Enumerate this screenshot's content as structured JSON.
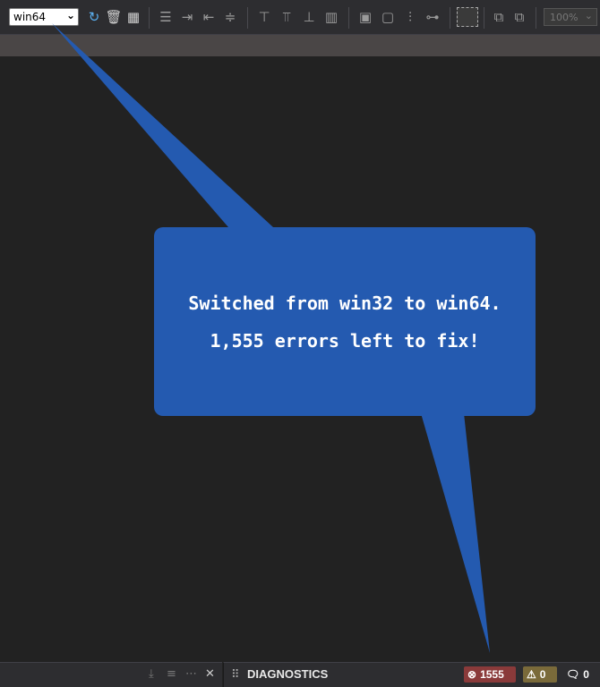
{
  "toolbar": {
    "platform": {
      "selected": "win64"
    },
    "zoom": {
      "selected": "100%"
    },
    "icons": [
      "refresh-icon",
      "delete-icon",
      "grid-icon",
      "align-left-icon",
      "indent-icon",
      "outdent-icon",
      "distribute-icon",
      "align-top-icon",
      "align-middle-icon",
      "align-bottom-icon",
      "chart-icon",
      "group-icon",
      "ungroup-icon",
      "hierarchy-icon",
      "link-icon",
      "select-all-icon",
      "bring-front-icon",
      "send-back-icon"
    ]
  },
  "callout": {
    "line1": "Switched from win32 to win64.",
    "line2": "1,555 errors left to fix!",
    "color": "#245ab0"
  },
  "diagnostics": {
    "title": "DIAGNOSTICS",
    "errors": "1555",
    "warnings": "0",
    "messages": "0",
    "error_color": "#8a3a3a",
    "warning_color": "#7a6a3a"
  }
}
